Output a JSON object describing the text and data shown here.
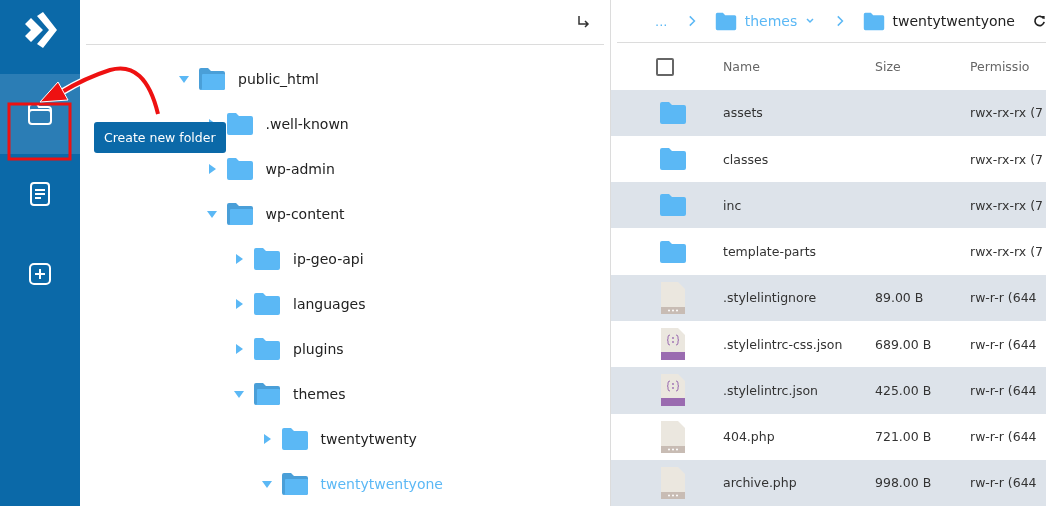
{
  "sidebar": {
    "items": [
      {
        "kind": "folder",
        "selected": true
      },
      {
        "kind": "document",
        "selected": false
      },
      {
        "kind": "add",
        "selected": false
      }
    ]
  },
  "tooltip": {
    "text": "Create new folder"
  },
  "tree": {
    "nodes": [
      {
        "name": "public_html",
        "expanded": true,
        "selected": false,
        "children": [
          {
            "name": ".well-known",
            "expanded": false,
            "selected": false
          },
          {
            "name": "wp-admin",
            "expanded": false,
            "selected": false
          },
          {
            "name": "wp-content",
            "expanded": true,
            "selected": false,
            "children": [
              {
                "name": "ip-geo-api",
                "expanded": false,
                "selected": false
              },
              {
                "name": "languages",
                "expanded": false,
                "selected": false
              },
              {
                "name": "plugins",
                "expanded": false,
                "selected": false
              },
              {
                "name": "themes",
                "expanded": true,
                "selected": false,
                "children": [
                  {
                    "name": "twentytwenty",
                    "expanded": false,
                    "selected": false
                  },
                  {
                    "name": "twentytwentyone",
                    "expanded": true,
                    "selected": true
                  }
                ]
              }
            ]
          }
        ]
      }
    ]
  },
  "breadcrumb": {
    "ellipsis": "...",
    "items": [
      {
        "name": "themes",
        "current": false
      },
      {
        "name": "twentytwentyone",
        "current": true
      }
    ]
  },
  "table": {
    "select_all": {
      "checked": false
    },
    "columns": [
      "Name",
      "Size",
      "Permissio"
    ],
    "rows": [
      {
        "kind": "folder",
        "name": "assets",
        "perm": "rwx-rx-rx (7"
      },
      {
        "kind": "folder",
        "name": "classes",
        "perm": "rwx-rx-rx (7"
      },
      {
        "kind": "folder",
        "name": "inc",
        "perm": "rwx-rx-rx (7"
      },
      {
        "kind": "folder",
        "name": "template-parts",
        "perm": "rwx-rx-rx (7"
      },
      {
        "kind": "file",
        "name": ".stylelintignore",
        "size": "89.00 B",
        "perm": "rw-r-r (644"
      },
      {
        "kind": "json",
        "name": ".stylelintrc-css.json",
        "size": "689.00 B",
        "perm": "rw-r-r (644"
      },
      {
        "kind": "json",
        "name": ".stylelintrc.json",
        "size": "425.00 B",
        "perm": "rw-r-r (644"
      },
      {
        "kind": "file",
        "name": "404.php",
        "size": "721.00 B",
        "perm": "rw-r-r (644"
      },
      {
        "kind": "file",
        "name": "archive.php",
        "size": "998.00 B",
        "perm": "rw-r-r (644"
      }
    ]
  }
}
